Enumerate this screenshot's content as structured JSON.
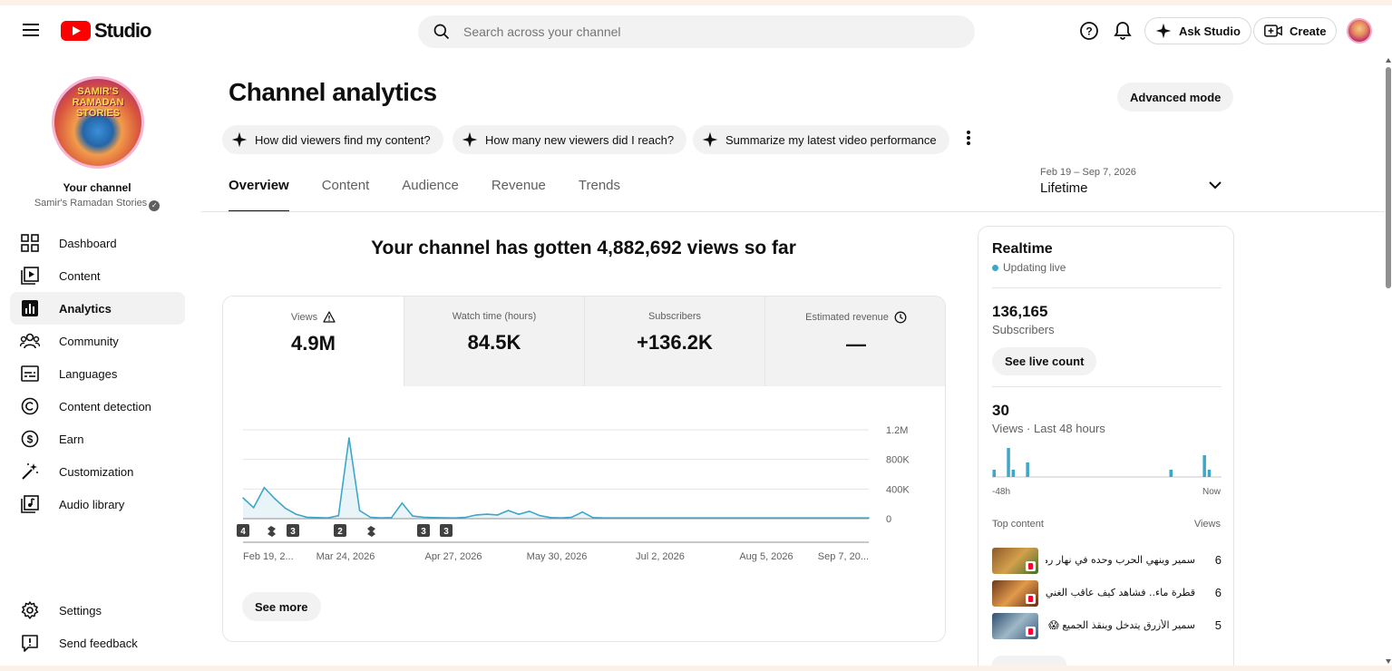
{
  "app": {
    "logo_text": "Studio"
  },
  "header": {
    "search_placeholder": "Search across your channel",
    "ask_studio": "Ask Studio",
    "create": "Create"
  },
  "sidebar": {
    "channel_label": "Your channel",
    "channel_name": "Samir's Ramadan Stories",
    "avatar_badge": "SAMIR'S RAMADAN STORIES",
    "items": [
      {
        "label": "Dashboard",
        "icon": "dashboard-icon"
      },
      {
        "label": "Content",
        "icon": "content-icon"
      },
      {
        "label": "Analytics",
        "icon": "analytics-icon",
        "active": true
      },
      {
        "label": "Community",
        "icon": "community-icon"
      },
      {
        "label": "Languages",
        "icon": "languages-icon"
      },
      {
        "label": "Content detection",
        "icon": "copyright-icon"
      },
      {
        "label": "Earn",
        "icon": "dollar-icon"
      },
      {
        "label": "Customization",
        "icon": "magic-wand-icon"
      },
      {
        "label": "Audio library",
        "icon": "audio-library-icon"
      }
    ],
    "bottom": [
      {
        "label": "Settings",
        "icon": "gear-icon"
      },
      {
        "label": "Send feedback",
        "icon": "feedback-icon"
      }
    ]
  },
  "main": {
    "title": "Channel analytics",
    "advanced_mode": "Advanced mode",
    "chips": [
      "How did viewers find my content?",
      "How many new viewers did I reach?",
      "Summarize my latest video performance"
    ],
    "tabs": [
      "Overview",
      "Content",
      "Audience",
      "Revenue",
      "Trends"
    ],
    "date_range": {
      "sub": "Feb 19 – Sep 7, 2026",
      "main": "Lifetime"
    },
    "headline": "Your channel has gotten 4,882,692 views so far",
    "metrics": [
      {
        "label": "Views",
        "value": "4.9M",
        "icon": "warning-icon"
      },
      {
        "label": "Watch time (hours)",
        "value": "84.5K"
      },
      {
        "label": "Subscribers",
        "value": "+136.2K"
      },
      {
        "label": "Estimated revenue",
        "value": "—",
        "icon": "clock-icon"
      }
    ],
    "see_more": "See more"
  },
  "chart_data": {
    "type": "area",
    "series": [
      {
        "values": [
          280000,
          150000,
          420000,
          270000,
          140000,
          60000,
          20000,
          15000,
          10000,
          40000,
          1090000,
          110000,
          20000,
          10000,
          15000,
          210000,
          35000,
          20000,
          15000,
          12000,
          10000,
          18000,
          50000,
          60000,
          50000,
          110000,
          60000,
          100000,
          40000,
          15000,
          10000,
          20000,
          90000,
          15000,
          10000,
          10000,
          10000,
          10000,
          10000,
          10000,
          10000,
          10000,
          10000,
          10000,
          10000,
          10000,
          10000,
          10000,
          10000,
          10000,
          10000,
          10000,
          10000,
          10000,
          10000,
          10000,
          10000,
          10000,
          10000,
          10000
        ]
      }
    ],
    "x_tick_labels": [
      "Feb 19, 2...",
      "Mar 24, 2026",
      "Apr 27, 2026",
      "May 30, 2026",
      "Jul 2, 2026",
      "Aug 5, 2026",
      "Sep 7, 20..."
    ],
    "y_tick_labels": [
      "1.2M",
      "800K",
      "400K",
      "0"
    ],
    "ylim": [
      0,
      1200000
    ],
    "markers": [
      "4",
      "shorts",
      "3",
      "2",
      "shorts",
      "3",
      "3"
    ],
    "color": "#3ea6c8",
    "grid": true
  },
  "realtime": {
    "title": "Realtime",
    "live": "Updating live",
    "subscribers_value": "136,165",
    "subscribers_label": "Subscribers",
    "see_live": "See live count",
    "views_value": "30",
    "views_label": "Views · Last 48 hours",
    "bars": [
      1,
      0,
      0,
      4,
      1,
      0,
      0,
      2,
      0,
      0,
      0,
      0,
      0,
      0,
      0,
      0,
      0,
      0,
      0,
      0,
      0,
      0,
      0,
      0,
      0,
      0,
      0,
      0,
      0,
      0,
      0,
      0,
      0,
      0,
      0,
      0,
      0,
      1,
      0,
      0,
      0,
      0,
      0,
      0,
      3,
      1,
      0,
      0
    ],
    "axis_start": "-48h",
    "axis_end": "Now",
    "top_content": "Top content",
    "views_col": "Views",
    "videos": [
      {
        "title": "سمير وينهي الحرب وحده في نهار رمضان",
        "views": "6"
      },
      {
        "title": "قطرة ماء.. فشاهد كيف عاقب الغني المتكبر",
        "views": "6"
      },
      {
        "title": "سمير الأزرق يتدخل وينقذ الجميع 😱 ...",
        "views": "5"
      }
    ]
  }
}
